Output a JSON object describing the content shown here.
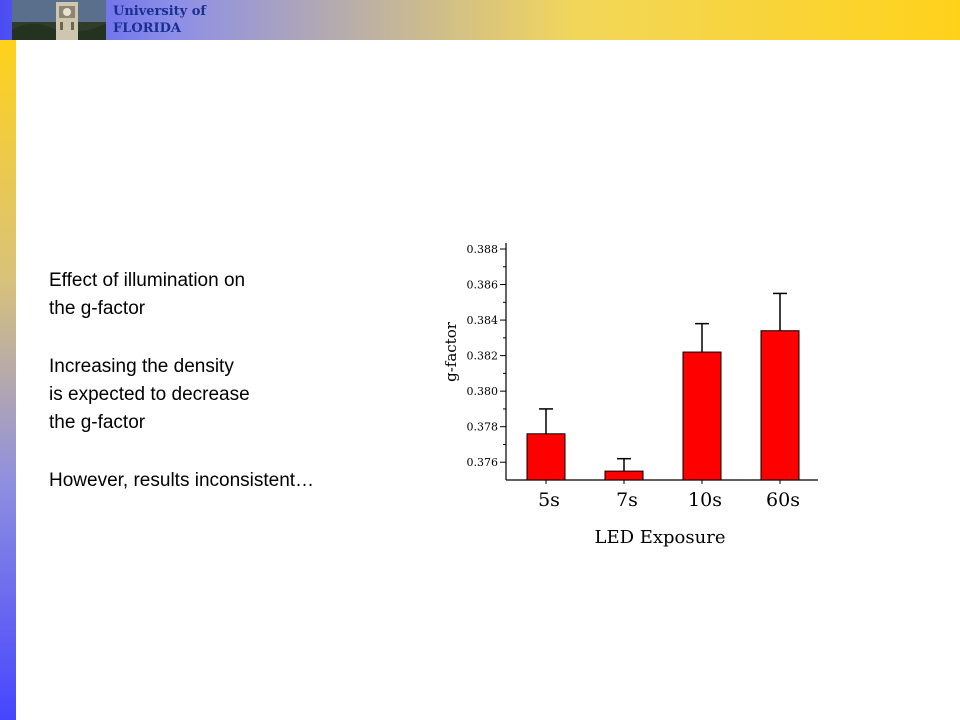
{
  "header": {
    "logo_line1": "University of",
    "logo_line2": "FLORIDA"
  },
  "colors": {
    "bar": "#ff0000",
    "header_left": "#4a4cf2",
    "header_right": "#ffd21a",
    "logo_text": "#1a2f8f"
  },
  "notes": {
    "line1": "Effect of illumination on",
    "line2": "the g-factor",
    "line3": "Increasing the density",
    "line4": "is expected to decrease",
    "line5": "the g-factor",
    "line6": "However, results inconsistent…"
  },
  "chart_data": {
    "type": "bar",
    "categories": [
      "5s",
      "7s",
      "10s",
      "60s"
    ],
    "values": [
      0.3776,
      0.3755,
      0.3822,
      0.3834
    ],
    "error": [
      0.0014,
      0.0007,
      0.0016,
      0.0021
    ],
    "xlabel": "LED Exposure",
    "ylabel": "g-factor",
    "ylim": [
      0.375,
      0.388
    ],
    "yticks": [
      "0.376",
      "0.378",
      "0.380",
      "0.382",
      "0.384",
      "0.386",
      "0.388"
    ],
    "grid": false
  }
}
